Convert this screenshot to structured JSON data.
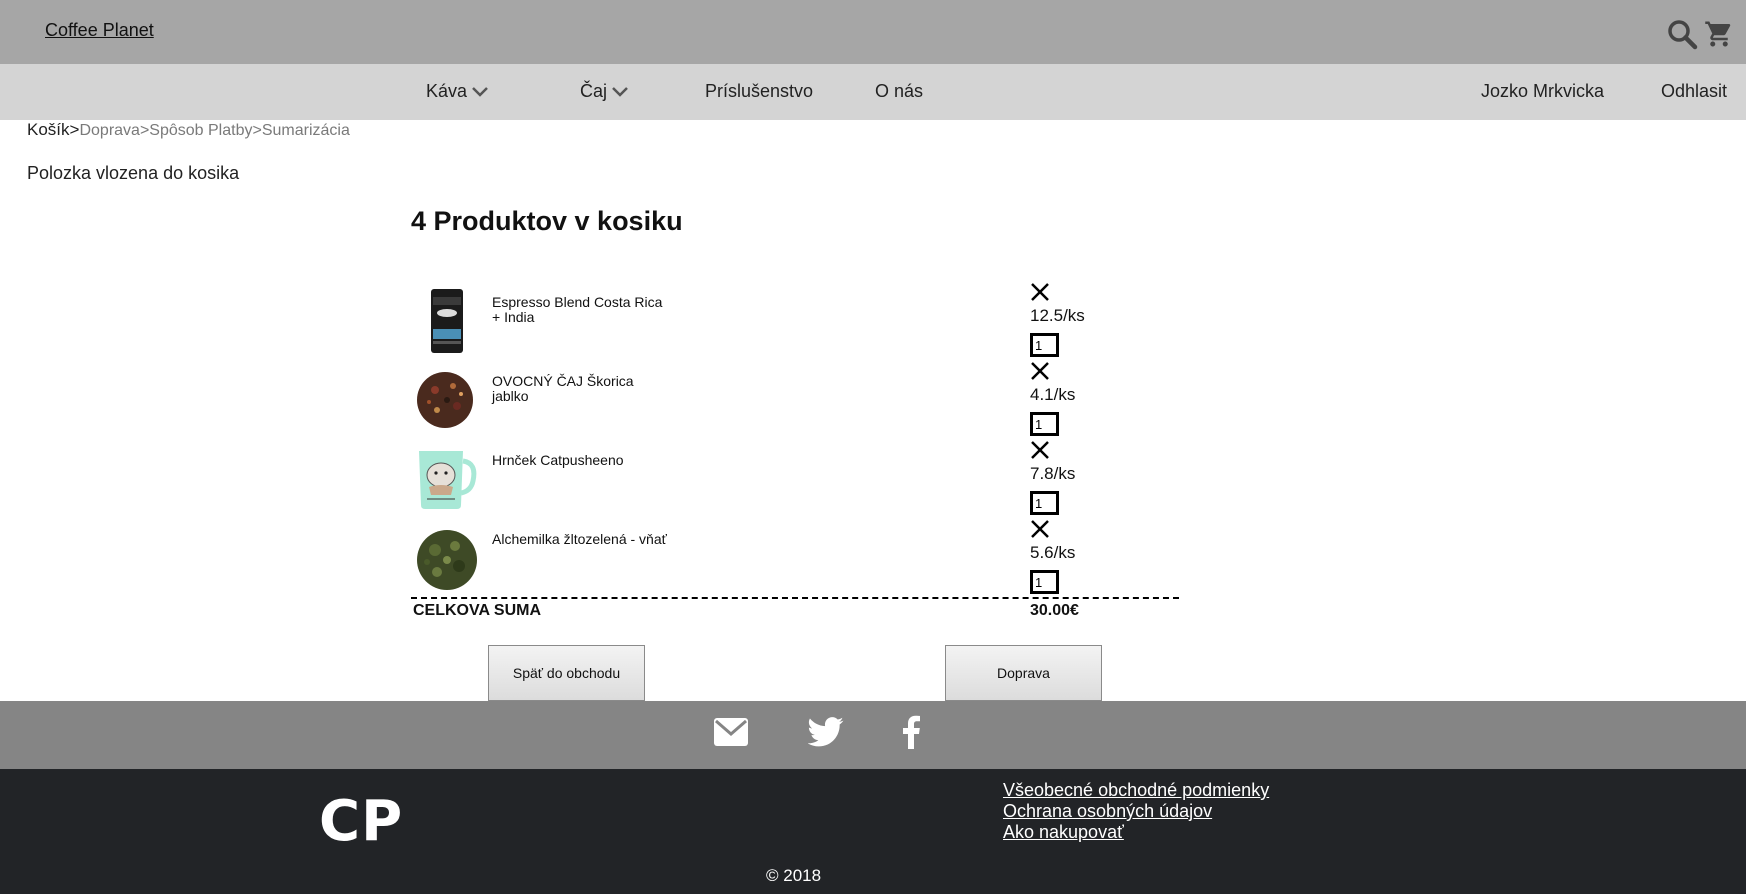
{
  "header": {
    "brand": "Coffee Planet",
    "icons": [
      "search-icon",
      "cart-icon"
    ]
  },
  "nav": {
    "items": [
      {
        "label": "Káva",
        "dropdown": true
      },
      {
        "label": "Čaj",
        "dropdown": true
      },
      {
        "label": "Príslušenstvo",
        "dropdown": false
      },
      {
        "label": "O nás",
        "dropdown": false
      }
    ],
    "user": "Jozko Mrkvicka",
    "logout": "Odhlasit"
  },
  "breadcrumb": {
    "current": "Košík",
    "sep": ">",
    "steps": [
      "Doprava",
      "Spôsob Platby",
      "Sumarizácia"
    ]
  },
  "notice": "Polozka vlozena do kosika",
  "cart": {
    "title": "4 Produktov v kosiku",
    "items": [
      {
        "name": "Espresso Blend Costa Rica + India",
        "price": "12.5/ks",
        "qty": "1",
        "image": "coffee-bag"
      },
      {
        "name": "OVOCNÝ ČAJ Škorica jablko",
        "price": "4.1/ks",
        "qty": "1",
        "image": "fruit-tea"
      },
      {
        "name": "Hrnček Catpusheeno",
        "price": "7.8/ks",
        "qty": "1",
        "image": "mug"
      },
      {
        "name": "Alchemilka žltozelená - vňať",
        "price": "5.6/ks",
        "qty": "1",
        "image": "herb"
      }
    ],
    "total_label": "CELKOVA SUMA",
    "total_value": "30.00€",
    "back_button": "Späť do obchodu",
    "next_button": "Doprava"
  },
  "social": [
    "mail-icon",
    "twitter-icon",
    "facebook-icon"
  ],
  "footer": {
    "logo": "CP",
    "links": [
      "Všeobecné obchodné podmienky",
      "Ochrana osobných údajov",
      "Ako nakupovať"
    ],
    "copyright": "© 2018"
  },
  "colors": {
    "topbar": "#a6a6a6",
    "navbar": "#d4d4d4",
    "social": "#858585",
    "footer": "#222427"
  }
}
